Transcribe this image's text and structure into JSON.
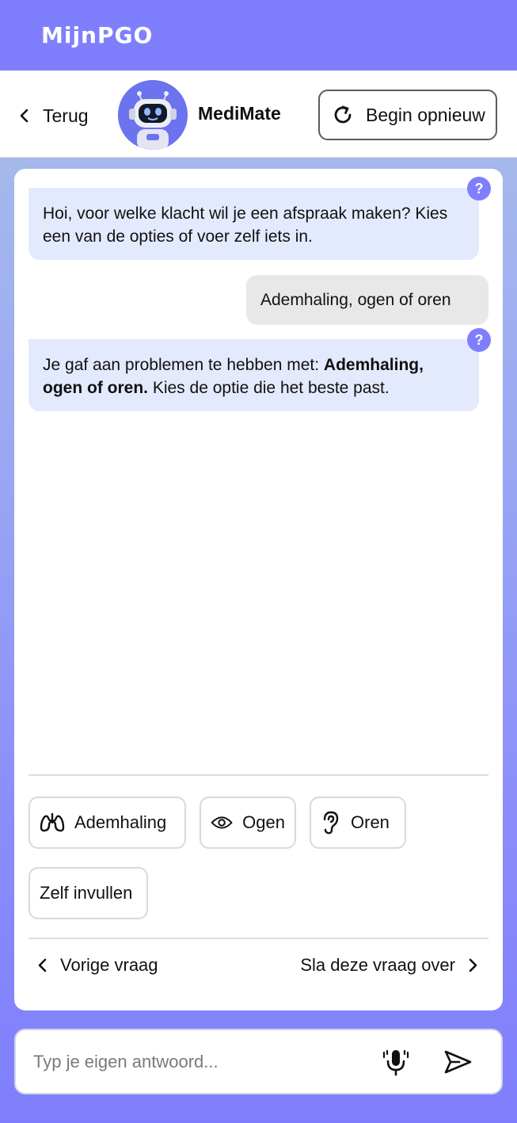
{
  "app": {
    "brand": "MijnPGO"
  },
  "header": {
    "back_label": "Terug",
    "bot_name": "MediMate",
    "restart_label": "Begin opnieuw"
  },
  "chat": {
    "messages": [
      {
        "from": "bot",
        "text": "Hoi, voor welke klacht wil je een afspraak maken? Kies een van de opties of voer zelf iets in."
      },
      {
        "from": "user",
        "text": "Ademhaling, ogen of oren"
      },
      {
        "from": "bot",
        "prefix": "Je gaf aan problemen te hebben met: ",
        "bold": "Ademhaling, ogen of oren.",
        "suffix": " Kies de optie die het beste past."
      }
    ],
    "help_label": "?"
  },
  "options": [
    {
      "label": "Ademhaling",
      "icon": "lungs-icon"
    },
    {
      "label": "Ogen",
      "icon": "eye-icon"
    },
    {
      "label": "Oren",
      "icon": "ear-icon"
    },
    {
      "label": "Zelf invullen"
    }
  ],
  "nav": {
    "prev_label": "Vorige vraag",
    "skip_label": "Sla deze vraag over"
  },
  "input": {
    "placeholder": "Typ je eigen antwoord...",
    "value": ""
  },
  "colors": {
    "accent": "#7f7ffd",
    "bot_bubble": "#e4eafd",
    "user_bubble": "#e8e8e8"
  }
}
